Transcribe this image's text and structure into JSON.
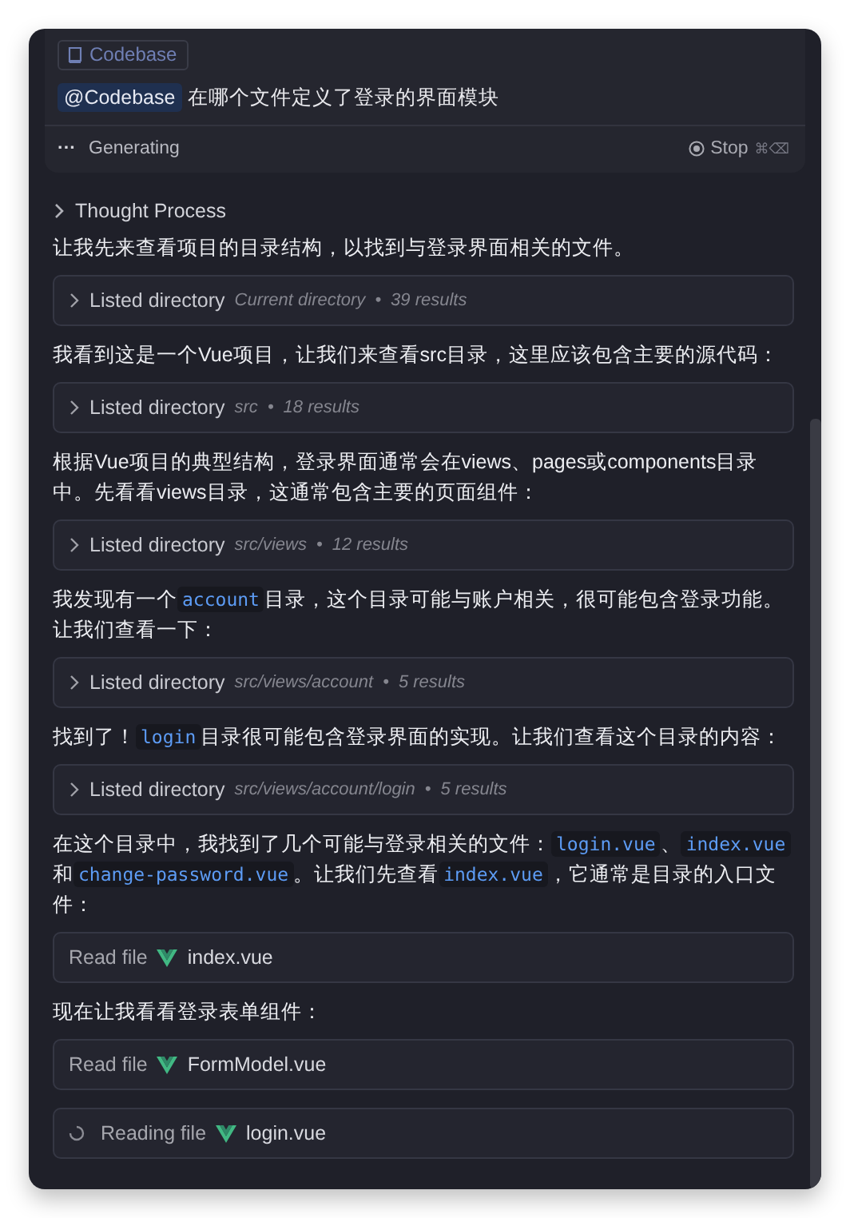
{
  "context_chip": {
    "label": "Codebase"
  },
  "query": {
    "mention": "@Codebase",
    "text": "在哪个文件定义了登录的界面模块"
  },
  "status": {
    "dots": "···",
    "label": "Generating",
    "stop": "Stop",
    "shortcut": "⌘⌫"
  },
  "thought": {
    "label": "Thought Process",
    "expanded": false
  },
  "items": [
    {
      "kind": "text",
      "segments": [
        {
          "kind": "plain",
          "text": "让我先来查看项目的目录结构，以找到与登录界面相关的文件。"
        }
      ]
    },
    {
      "kind": "listed",
      "action": "Listed directory",
      "path": "Current directory",
      "sep": "•",
      "count": "39 results"
    },
    {
      "kind": "text",
      "segments": [
        {
          "kind": "plain",
          "text": "我看到这是一个Vue项目，让我们来查看src目录，这里应该包含主要的源代码："
        }
      ]
    },
    {
      "kind": "listed",
      "action": "Listed directory",
      "path": "src",
      "sep": "•",
      "count": "18 results"
    },
    {
      "kind": "text",
      "segments": [
        {
          "kind": "plain",
          "text": "根据Vue项目的典型结构，登录界面通常会在views、pages或components目录中。先看看views目录，这通常包含主要的页面组件："
        }
      ]
    },
    {
      "kind": "listed",
      "action": "Listed directory",
      "path": "src/views",
      "sep": "•",
      "count": "12 results"
    },
    {
      "kind": "text",
      "segments": [
        {
          "kind": "plain",
          "text": "我发现有一个"
        },
        {
          "kind": "code",
          "text": "account"
        },
        {
          "kind": "plain",
          "text": "目录，这个目录可能与账户相关，很可能包含登录功能。让我们查看一下："
        }
      ]
    },
    {
      "kind": "listed",
      "action": "Listed directory",
      "path": "src/views/account",
      "sep": "•",
      "count": "5 results"
    },
    {
      "kind": "text",
      "segments": [
        {
          "kind": "plain",
          "text": "找到了！"
        },
        {
          "kind": "code",
          "text": "login"
        },
        {
          "kind": "plain",
          "text": "目录很可能包含登录界面的实现。让我们查看这个目录的内容："
        }
      ]
    },
    {
      "kind": "listed",
      "action": "Listed directory",
      "path": "src/views/account/login",
      "sep": "•",
      "count": "5 results"
    },
    {
      "kind": "text",
      "segments": [
        {
          "kind": "plain",
          "text": "在这个目录中，我找到了几个可能与登录相关的文件："
        },
        {
          "kind": "code",
          "text": "login.vue"
        },
        {
          "kind": "plain",
          "text": "、"
        },
        {
          "kind": "code",
          "text": "index.vue"
        },
        {
          "kind": "plain",
          "text": "和"
        },
        {
          "kind": "code",
          "text": "change-password.vue"
        },
        {
          "kind": "plain",
          "text": "。让我们先查看"
        },
        {
          "kind": "code",
          "text": "index.vue"
        },
        {
          "kind": "plain",
          "text": "，它通常是目录的入口文件："
        }
      ]
    },
    {
      "kind": "read",
      "action": "Read file",
      "file": "index.vue"
    },
    {
      "kind": "text",
      "segments": [
        {
          "kind": "plain",
          "text": "现在让我看看登录表单组件："
        }
      ]
    },
    {
      "kind": "read",
      "action": "Read file",
      "file": "FormModel.vue"
    },
    {
      "kind": "reading",
      "action": "Reading file",
      "file": "login.vue"
    }
  ]
}
